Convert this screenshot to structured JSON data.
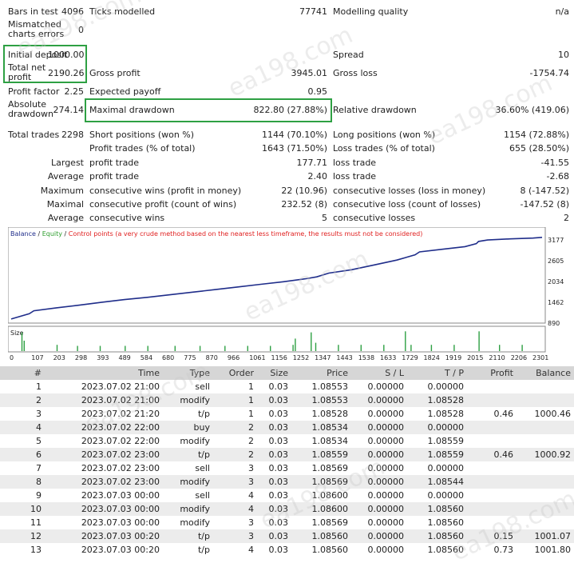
{
  "stats": {
    "bars_in_test_label": "Bars in test",
    "bars_in_test": "4096",
    "ticks_modelled_label": "Ticks modelled",
    "ticks_modelled": "77741",
    "modelling_quality_label": "Modelling quality",
    "modelling_quality": "n/a",
    "mismatched_label": "Mismatched charts errors",
    "mismatched": "0",
    "initial_deposit_label": "Initial deposit",
    "initial_deposit": "1000.00",
    "spread_label": "Spread",
    "spread": "10",
    "total_net_profit_label": "Total net profit",
    "total_net_profit": "2190.26",
    "gross_profit_label": "Gross profit",
    "gross_profit": "3945.01",
    "gross_loss_label": "Gross loss",
    "gross_loss": "-1754.74",
    "profit_factor_label": "Profit factor",
    "profit_factor": "2.25",
    "expected_payoff_label": "Expected payoff",
    "expected_payoff": "0.95",
    "absolute_drawdown_label": "Absolute drawdown",
    "absolute_drawdown": "274.14",
    "maximal_drawdown_label": "Maximal drawdown",
    "maximal_drawdown": "822.80 (27.88%)",
    "relative_drawdown_label": "Relative drawdown",
    "relative_drawdown": "36.60% (419.06)",
    "total_trades_label": "Total trades",
    "total_trades": "2298",
    "short_positions_label": "Short positions (won %)",
    "short_positions": "1144 (70.10%)",
    "long_positions_label": "Long positions (won %)",
    "long_positions": "1154 (72.88%)",
    "profit_trades_label": "Profit trades (% of total)",
    "profit_trades": "1643 (71.50%)",
    "loss_trades_label": "Loss trades (% of total)",
    "loss_trades": "655 (28.50%)",
    "largest_label": "Largest",
    "largest_profit_label": "profit trade",
    "largest_profit": "177.71",
    "largest_loss_label": "loss trade",
    "largest_loss": "-41.55",
    "average_label": "Average",
    "average_profit_label": "profit trade",
    "average_profit": "2.40",
    "average_loss_label": "loss trade",
    "average_loss": "-2.68",
    "maximum_label": "Maximum",
    "max_consec_wins_label": "consecutive wins (profit in money)",
    "max_consec_wins": "22 (10.96)",
    "max_consec_losses_label": "consecutive losses (loss in money)",
    "max_consec_losses": "8 (-147.52)",
    "maximal_label": "Maximal",
    "maximal_consec_profit_label": "consecutive profit (count of wins)",
    "maximal_consec_profit": "232.52 (8)",
    "maximal_consec_loss_label": "consecutive loss (count of losses)",
    "maximal_consec_loss": "-147.52 (8)",
    "average2_label": "Average",
    "avg_consec_wins_label": "consecutive wins",
    "avg_consec_wins": "5",
    "avg_consec_losses_label": "consecutive losses",
    "avg_consec_losses": "2"
  },
  "chart_legend": {
    "balance": "Balance",
    "sep1": " / ",
    "equity": "Equity",
    "sep2": " / ",
    "control": "Control points (a very crude method based on the nearest less timeframe, the results must not be considered)"
  },
  "colors": {
    "balance": "#1f2d8a",
    "equity": "#2e9e2e",
    "control": "#e02020",
    "highlight_box": "#2ea043",
    "size_bars": "#2ea043"
  },
  "chart_data": {
    "type": "line",
    "series": [
      {
        "name": "Balance",
        "x": [
          0,
          80,
          100,
          200,
          300,
          400,
          500,
          600,
          700,
          800,
          900,
          1000,
          1100,
          1200,
          1300,
          1347,
          1400,
          1500,
          1600,
          1700,
          1780,
          1800,
          1900,
          2000,
          2050,
          2060,
          2100,
          2200,
          2300,
          2340
        ],
        "values": [
          1000,
          1140,
          1220,
          1300,
          1370,
          1450,
          1520,
          1580,
          1650,
          1720,
          1790,
          1860,
          1930,
          2000,
          2080,
          2130,
          2230,
          2320,
          2450,
          2580,
          2720,
          2800,
          2870,
          2940,
          3020,
          3080,
          3120,
          3150,
          3170,
          3190
        ]
      }
    ],
    "y_ticks": [
      "3177",
      "2605",
      "2034",
      "1462",
      "890"
    ],
    "ylim": [
      890,
      3250
    ],
    "size_panel_label": "Size",
    "size_x_ticks": [
      "0",
      "107",
      "203",
      "298",
      "393",
      "489",
      "584",
      "680",
      "775",
      "870",
      "966",
      "1061",
      "1156",
      "1252",
      "1347",
      "1443",
      "1538",
      "1633",
      "1729",
      "1824",
      "1919",
      "2015",
      "2110",
      "2206",
      "2301"
    ],
    "size_bars": [
      {
        "x": 45,
        "v": 0.9
      },
      {
        "x": 55,
        "v": 0.5
      },
      {
        "x": 200,
        "v": 0.3
      },
      {
        "x": 290,
        "v": 0.25
      },
      {
        "x": 390,
        "v": 0.25
      },
      {
        "x": 500,
        "v": 0.25
      },
      {
        "x": 600,
        "v": 0.25
      },
      {
        "x": 720,
        "v": 0.25
      },
      {
        "x": 830,
        "v": 0.25
      },
      {
        "x": 940,
        "v": 0.25
      },
      {
        "x": 1040,
        "v": 0.25
      },
      {
        "x": 1140,
        "v": 0.25
      },
      {
        "x": 1240,
        "v": 0.3
      },
      {
        "x": 1250,
        "v": 0.6
      },
      {
        "x": 1320,
        "v": 0.9
      },
      {
        "x": 1340,
        "v": 0.4
      },
      {
        "x": 1440,
        "v": 0.3
      },
      {
        "x": 1540,
        "v": 0.3
      },
      {
        "x": 1640,
        "v": 0.3
      },
      {
        "x": 1735,
        "v": 0.95
      },
      {
        "x": 1760,
        "v": 0.3
      },
      {
        "x": 1850,
        "v": 0.3
      },
      {
        "x": 1950,
        "v": 0.3
      },
      {
        "x": 2060,
        "v": 0.95
      },
      {
        "x": 2150,
        "v": 0.3
      },
      {
        "x": 2250,
        "v": 0.3
      }
    ]
  },
  "table": {
    "headers": [
      "#",
      "Time",
      "Type",
      "Order",
      "Size",
      "Price",
      "S / L",
      "T / P",
      "Profit",
      "Balance"
    ],
    "rows": [
      [
        "1",
        "2023.07.02 21:00",
        "sell",
        "1",
        "0.03",
        "1.08553",
        "0.00000",
        "0.00000",
        "",
        ""
      ],
      [
        "2",
        "2023.07.02 21:00",
        "modify",
        "1",
        "0.03",
        "1.08553",
        "0.00000",
        "1.08528",
        "",
        ""
      ],
      [
        "3",
        "2023.07.02 21:20",
        "t/p",
        "1",
        "0.03",
        "1.08528",
        "0.00000",
        "1.08528",
        "0.46",
        "1000.46"
      ],
      [
        "4",
        "2023.07.02 22:00",
        "buy",
        "2",
        "0.03",
        "1.08534",
        "0.00000",
        "0.00000",
        "",
        ""
      ],
      [
        "5",
        "2023.07.02 22:00",
        "modify",
        "2",
        "0.03",
        "1.08534",
        "0.00000",
        "1.08559",
        "",
        ""
      ],
      [
        "6",
        "2023.07.02 23:00",
        "t/p",
        "2",
        "0.03",
        "1.08559",
        "0.00000",
        "1.08559",
        "0.46",
        "1000.92"
      ],
      [
        "7",
        "2023.07.02 23:00",
        "sell",
        "3",
        "0.03",
        "1.08569",
        "0.00000",
        "0.00000",
        "",
        ""
      ],
      [
        "8",
        "2023.07.02 23:00",
        "modify",
        "3",
        "0.03",
        "1.08569",
        "0.00000",
        "1.08544",
        "",
        ""
      ],
      [
        "9",
        "2023.07.03 00:00",
        "sell",
        "4",
        "0.03",
        "1.08600",
        "0.00000",
        "0.00000",
        "",
        ""
      ],
      [
        "10",
        "2023.07.03 00:00",
        "modify",
        "4",
        "0.03",
        "1.08600",
        "0.00000",
        "1.08560",
        "",
        ""
      ],
      [
        "11",
        "2023.07.03 00:00",
        "modify",
        "3",
        "0.03",
        "1.08569",
        "0.00000",
        "1.08560",
        "",
        ""
      ],
      [
        "12",
        "2023.07.03 00:20",
        "t/p",
        "3",
        "0.03",
        "1.08560",
        "0.00000",
        "1.08560",
        "0.15",
        "1001.07"
      ],
      [
        "13",
        "2023.07.03 00:20",
        "t/p",
        "4",
        "0.03",
        "1.08560",
        "0.00000",
        "1.08560",
        "0.73",
        "1001.80"
      ]
    ]
  },
  "watermark": "ea198.com"
}
